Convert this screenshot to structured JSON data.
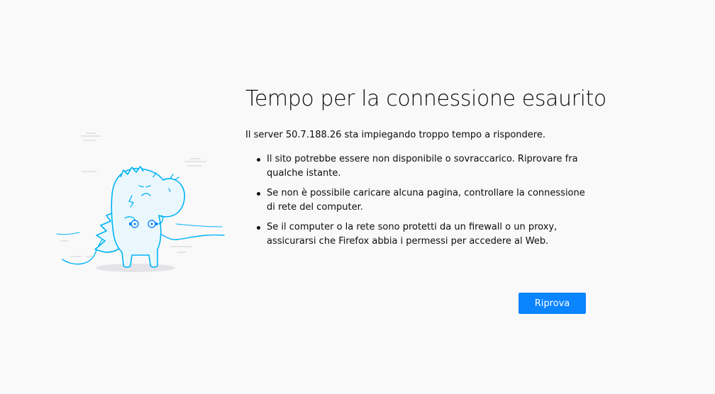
{
  "error": {
    "title": "Tempo per la connessione esaurito",
    "description": "Il server 50.7.188.26 sta impiegando troppo tempo a rispondere.",
    "reasons": [
      "Il sito potrebbe essere non disponibile o sovraccarico. Riprovare fra qualche istante.",
      "Se non è possibile caricare alcuna pagina, controllare la connessione di rete del computer.",
      "Se il computer o la rete sono protetti da un firewall o un proxy, assicurarsi che Firefox abbia i permessi per accedere al Web."
    ],
    "retry_label": "Riprova"
  },
  "illustration": {
    "icon": "unplugged-dinosaur-icon",
    "line_color": "#00b3f4",
    "fill_color": "#eaf8fe"
  },
  "colors": {
    "background": "#f9f9fa",
    "accent": "#0a84ff",
    "text": "#0c0c0d"
  }
}
